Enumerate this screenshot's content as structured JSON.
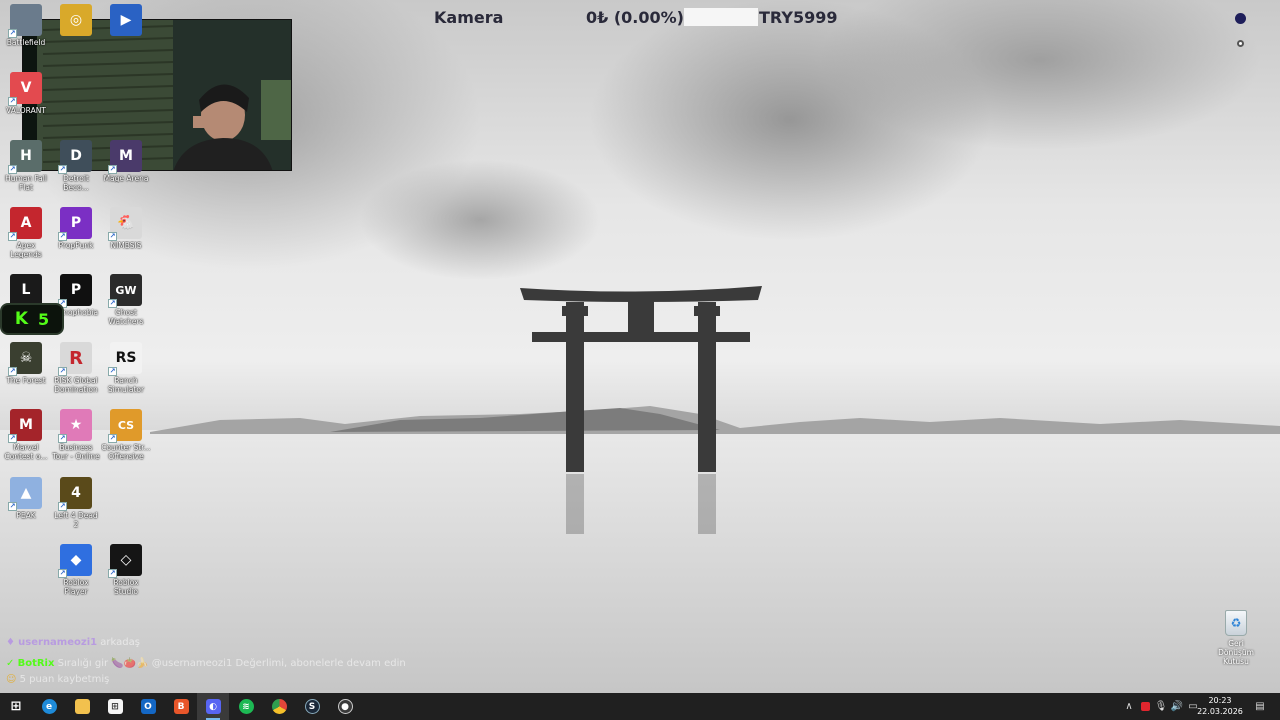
{
  "overlay": {
    "camera_label": "Kamera",
    "donation_amount": "0₺ (0.00%)",
    "donation_goal": "TRY5999"
  },
  "kick": {
    "logo": "K",
    "viewer_count": "5"
  },
  "desktop_icons": [
    {
      "label": "Battlefield",
      "color": "#6a7b8c",
      "glyph": "",
      "icon": "battlefield-icon"
    },
    {
      "label": "",
      "color": "#d9a92a",
      "glyph": "◎",
      "icon": "game-ring-icon"
    },
    {
      "label": "",
      "color": "#2a62c4",
      "glyph": "▶",
      "icon": "app-icon"
    },
    {
      "label": "VALORANT",
      "color": "#e34a4f",
      "glyph": "V",
      "icon": "valorant-icon"
    },
    {
      "label": "Human Fall Flat",
      "color": "#5a6d6a",
      "glyph": "H",
      "icon": "human-fall-flat-icon"
    },
    {
      "label": "Detroit Beco...",
      "color": "#3f4e5a",
      "glyph": "D",
      "icon": "detroit-icon"
    },
    {
      "label": "Mage Arena",
      "color": "#4a3a6a",
      "glyph": "M",
      "icon": "mage-arena-icon"
    },
    {
      "label": "Apex Legends",
      "color": "#c4262e",
      "glyph": "A",
      "icon": "apex-legends-icon"
    },
    {
      "label": "PropPunk",
      "color": "#7b2fc4",
      "glyph": "P",
      "icon": "proppunk-icon"
    },
    {
      "label": "NIMBSIS",
      "color": "#d9d9d9",
      "glyph": "🐔",
      "icon": "nimbsis-icon"
    },
    {
      "label": "",
      "color": "#1a1a1a",
      "glyph": "L",
      "icon": "app-icon-2"
    },
    {
      "label": "Xenophobia",
      "color": "#101010",
      "glyph": "P",
      "icon": "xenophobia-icon"
    },
    {
      "label": "Ghost Watchers",
      "color": "#2b2b2b",
      "glyph": "GW",
      "icon": "ghost-watchers-icon"
    },
    {
      "label": "The Forest",
      "color": "#3a3f30",
      "glyph": "☠",
      "icon": "the-forest-icon"
    },
    {
      "label": "RISK Global Domination",
      "color": "#d9d9d9",
      "glyph": "R",
      "icon": "risk-icon"
    },
    {
      "label": "Ranch Simulator",
      "color": "#f2f2f2",
      "glyph": "RS",
      "icon": "ranch-simulator-icon"
    },
    {
      "label": "Marvel Contest o...",
      "color": "#a4242a",
      "glyph": "M",
      "icon": "marvel-contest-icon"
    },
    {
      "label": "Business Tour - Online Mu...",
      "color": "#e07ab8",
      "glyph": "★",
      "icon": "business-tour-icon"
    },
    {
      "label": "Counter Str... Offensive",
      "color": "#e09a2a",
      "glyph": "CS",
      "icon": "counter-strike-icon"
    },
    {
      "label": "PEAK",
      "color": "#8fb1e0",
      "glyph": "▲",
      "icon": "peak-icon"
    },
    {
      "label": "Left 4 Dead 2",
      "color": "#5a4a1a",
      "glyph": "4",
      "icon": "left-4-dead-icon"
    },
    {
      "label": "Roblox Player",
      "color": "#2f6fe0",
      "glyph": "◆",
      "icon": "roblox-player-icon"
    },
    {
      "label": "Roblox Studio",
      "color": "#151515",
      "glyph": "◇",
      "icon": "roblox-studio-icon"
    }
  ],
  "chat": [
    {
      "badge": "♦",
      "user": "usernameozi1",
      "user_color": "#b89be0",
      "text": "arkadaş"
    },
    {
      "badge": "✓",
      "user": "BotRix",
      "user_color": "#53fc18",
      "text": "Sıralığı gir 🍆🍅🍌 @usernameozi1 Değerlimi, abonelerle devam edin"
    },
    {
      "badge": "☺",
      "user": "",
      "user_color": "#ffffff",
      "text": "5 puan kaybetmiş"
    }
  ],
  "recycle_bin": {
    "label": "Geri Dönüşüm Kutusu"
  },
  "taskbar": {
    "apps": [
      {
        "name": "start-button",
        "color": "#202020",
        "glyph": "⊞",
        "active": false
      },
      {
        "name": "edge-taskbar-icon",
        "color": "#1e8bd9",
        "glyph": "e",
        "active": false
      },
      {
        "name": "file-explorer-taskbar-icon",
        "color": "#f2c14e",
        "glyph": "▭",
        "active": false
      },
      {
        "name": "store-taskbar-icon",
        "color": "#f5f5f5",
        "glyph": "⊞",
        "active": false
      },
      {
        "name": "outlook-taskbar-icon",
        "color": "#1467c4",
        "glyph": "O",
        "active": false
      },
      {
        "name": "brave-taskbar-icon",
        "color": "#e8562a",
        "glyph": "B",
        "active": false
      },
      {
        "name": "discord-taskbar-icon",
        "color": "#5865f2",
        "glyph": "◐",
        "active": true
      },
      {
        "name": "spotify-taskbar-icon",
        "color": "#1db954",
        "glyph": "≋",
        "active": false
      },
      {
        "name": "chrome-taskbar-icon",
        "color": "#e2463a",
        "glyph": "◉",
        "active": false
      },
      {
        "name": "steam-taskbar-icon",
        "color": "#1b2838",
        "glyph": "S",
        "active": false
      },
      {
        "name": "obs-taskbar-icon",
        "color": "#3a3a3a",
        "glyph": "●",
        "active": false
      }
    ],
    "tray_icons": [
      "chevron-up-icon",
      "record-icon",
      "microphone-icon",
      "volume-icon",
      "display-icon",
      "speaker-icon"
    ],
    "time": "20:23",
    "date": "22.03.2026"
  }
}
